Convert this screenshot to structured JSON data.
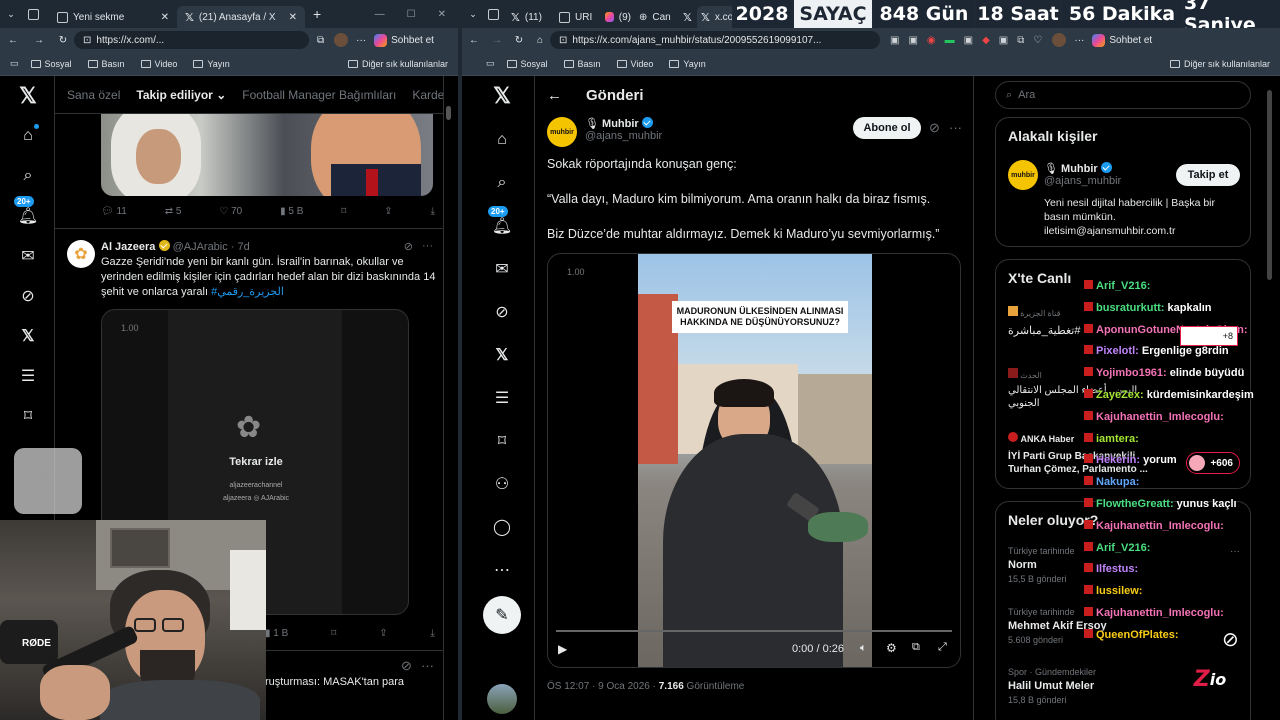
{
  "left_window": {
    "tabs": [
      {
        "label": "Yeni sekme"
      },
      {
        "label": "(21) Anasayfa / X"
      }
    ],
    "address": "https://x.com/...",
    "chat_button": "Sohbet et",
    "bookmarks": [
      "Sosyal",
      "Basın",
      "Video",
      "Yayın"
    ],
    "bookmarks_other": "Diğer sık kullanılanlar",
    "notif_badge": "20+",
    "feed_tabs": [
      "Sana özel",
      "Takip ediliyor",
      "Football Manager Bağımlıları",
      "Karde"
    ],
    "post1_actions": {
      "replies": "11",
      "reposts": "5",
      "likes": "70",
      "views": "5 B"
    },
    "post2": {
      "name": "Al Jazeera",
      "handle": "@AJArabic",
      "time": "· 7d",
      "text": "Gazze Şeridi'nde yeni bir kanlı gün. İsrail'in barınak, okullar ve yerinden edilmiş kişiler için çadırları hedef alan bir dizi baskınında 14 şehit ve onlarca yaralı",
      "hashtag": "#الجزيرة_رقمي",
      "speed": "1.00",
      "replay": "Tekrar izle",
      "channel": "aljazeerachannel",
      "channel2": "aljazeera",
      "channel3": "AJArabic",
      "views": "1 B"
    },
    "post3_text": "ruşturması: MASAK'tan para"
  },
  "right_window": {
    "tabs": [
      {
        "label": "(11)"
      },
      {
        "label": "URI"
      },
      {
        "label": "(9)"
      },
      {
        "label": "Can"
      },
      {
        "label": "x.co"
      }
    ],
    "counter": {
      "year": "2028",
      "label": "SAYAÇ",
      "days": "848 Gün",
      "hours": "18 Saat",
      "minutes": "56 Dakika",
      "seconds": "37 Saniye"
    },
    "address": "https://x.com/ajans_muhbir/status/2009552619099107...",
    "chat_button": "Sohbet et",
    "bookmarks": [
      "Sosyal",
      "Basın",
      "Video",
      "Yayın"
    ],
    "bookmarks_other": "Diğer sık kullanılanlar",
    "notif_badge": "20+",
    "header_title": "Gönderi",
    "post": {
      "avatar_text": "muhbir",
      "name": "Muhbir",
      "handle": "@ajans_muhbir",
      "follow": "Abone ol",
      "line1": "Sokak röportajında konuşan genç:",
      "line2": "“Valla dayı, Maduro kim bilmiyorum. Ama oranın halkı da biraz fısmış.",
      "line3": "Biz Düzce’de muhtar aldırmayız. Demek ki Maduro’yu sevmiyorlarmış.”",
      "speed": "1.00",
      "caption": "MADURONUN ÜLKESİNDEN ALINMASI HAKKINDA NE DÜŞÜNÜYORSUNUZ?",
      "time": "0:00 / 0:26",
      "meta_time": "ÖS 12:07 · 9 Oca 2026 ·",
      "meta_views": "7.166",
      "meta_views_label": "Görüntüleme"
    },
    "search_placeholder": "Ara",
    "related": {
      "title": "Alakalı kişiler",
      "name": "Muhbir",
      "handle": "@ajans_muhbir",
      "follow": "Takip et",
      "bio": "Yeni nesil dijital habercilik | Başka bir basın mümkün. iletisim@ajansmuhbir.com.tr"
    },
    "live": {
      "title": "X'te Canlı",
      "item1_name": "قناة الجزيرة",
      "item1_text": "تغطية_مباشرة#",
      "item2_name": "الحدث",
      "item2_text": "اليمن.. أعضاء المجلس الانتقالي الجنوبي",
      "item3_name": "ANKA Haber",
      "item3_text": "İYİ Parti Grup Başkanvekili Turhan Çömez, Parlamento ..."
    },
    "happening": {
      "title": "Neler oluyor?",
      "items": [
        {
          "meta": "Türkiye tarihinde",
          "name": "Norm",
          "count": "15,5 B gönderi"
        },
        {
          "meta": "Türkiye tarihinde",
          "name": "Mehmet Akif Ersoy",
          "count": "5.608 gönderi"
        },
        {
          "meta": "Spor · Gündemdekiler",
          "name": "Halil Umut Meler",
          "count": "15,8 B gönderi"
        }
      ]
    }
  },
  "chat_overlay": [
    {
      "user": "Arif_V216:",
      "msg": "",
      "color": "#4ade80"
    },
    {
      "user": "busraturkutt:",
      "msg": "kapkalın",
      "color": "#4ade80"
    },
    {
      "user": "AponunGotuneNesteleGiren:",
      "msg": "",
      "color": "#f472b6"
    },
    {
      "user": "Pixelotl:",
      "msg": "Ergenlige g8rdin",
      "color": "#c084fc"
    },
    {
      "user": "Yojimbo1961:",
      "msg": "elinde büyüdü",
      "color": "#f472b6"
    },
    {
      "user": "ZayeZex:",
      "msg": "kürdemisinkardeşim",
      "color": "#a3e635"
    },
    {
      "user": "Kajuhanettin_Imlecoglu:",
      "msg": "",
      "color": "#f472b6"
    },
    {
      "user": "iamtera:",
      "msg": "",
      "color": "#a3e635"
    },
    {
      "user": "Hekerin:",
      "msg": "yorum",
      "color": "#c084fc"
    },
    {
      "user": "Nakupa:",
      "msg": "",
      "color": "#60a5fa"
    },
    {
      "user": "FlowtheGreatt:",
      "msg": "yunus kaçlı",
      "color": "#4ade80"
    },
    {
      "user": "Kajuhanettin_Imlecoglu:",
      "msg": "",
      "color": "#f472b6"
    },
    {
      "user": "Arif_V216:",
      "msg": "",
      "color": "#4ade80"
    },
    {
      "user": "Ilfestus:",
      "msg": "",
      "color": "#c084fc"
    },
    {
      "user": "lussilew:",
      "msg": "",
      "color": "#facc15"
    },
    {
      "user": "Kajuhanettin_Imlecoglu:",
      "msg": "",
      "color": "#f472b6"
    },
    {
      "user": "QueenOfPlates:",
      "msg": "",
      "color": "#facc15"
    }
  ],
  "chat_badge_count": "+606",
  "chat_small_count": "+8",
  "webcam_brand": "RØDE",
  "watermark": "Z"
}
